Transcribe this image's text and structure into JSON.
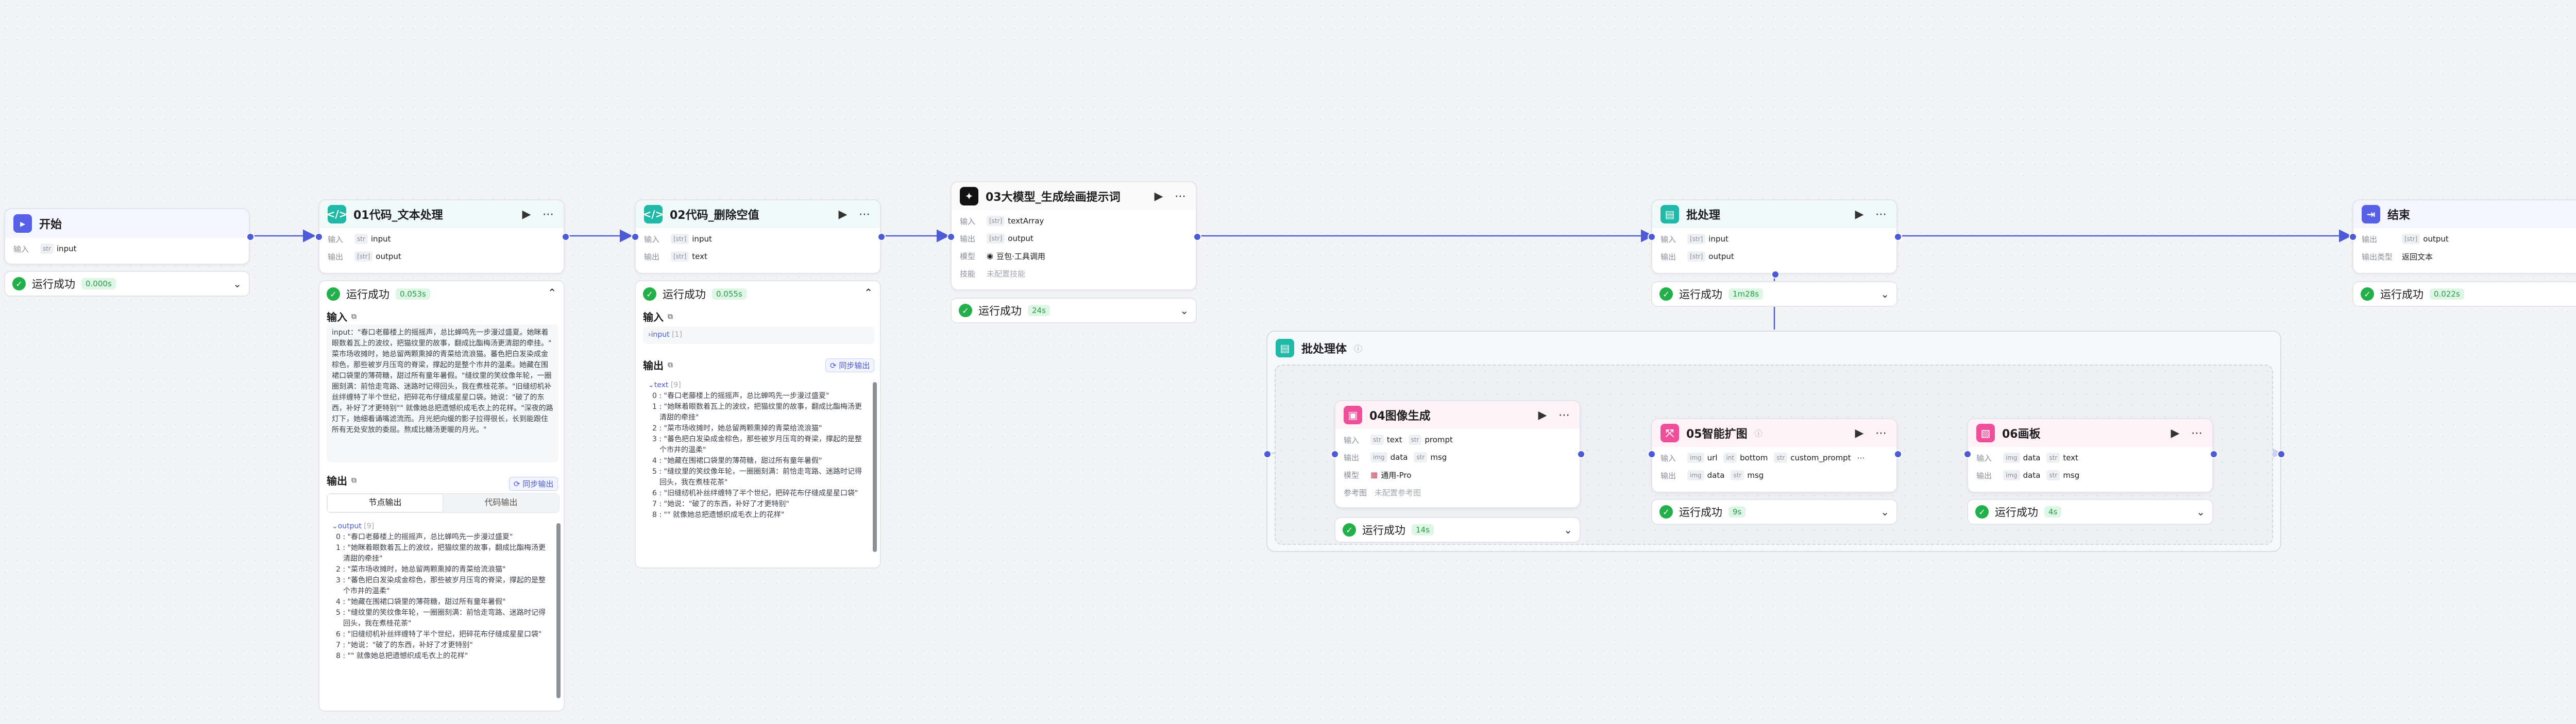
{
  "nodes": {
    "start": {
      "title": "开始",
      "input_label": "输入",
      "input_var": "input"
    },
    "n01": {
      "title": "01代码_文本处理",
      "in_label": "输入",
      "out_label": "输出",
      "in_var": "input",
      "out_var": "output"
    },
    "n02": {
      "title": "02代码_删除空值",
      "in_label": "输入",
      "out_label": "输出",
      "in_var": "input",
      "out_var": "text"
    },
    "n03": {
      "title": "03大模型_生成绘画提示词",
      "in_label": "输入",
      "out_label": "输出",
      "model_label": "模型",
      "skill_label": "技能",
      "in_var": "textArray",
      "out_var": "output",
      "model_value": "豆包·工具调用",
      "skill_value": "未配置技能"
    },
    "batch": {
      "title": "批处理",
      "in_label": "输入",
      "out_label": "输出",
      "in_var": "input",
      "out_var": "output"
    },
    "end": {
      "title": "结束",
      "out_label": "输出",
      "type_label": "输出类型",
      "out_var": "output",
      "type_value": "返回文本"
    },
    "batch_body": {
      "title": "批处理体",
      "info_icon": "info-icon"
    },
    "n04": {
      "title": "04图像生成",
      "in_label": "输入",
      "out_label": "输出",
      "model_label": "模型",
      "ref_label": "参考图",
      "in_vars": [
        "text",
        "prompt"
      ],
      "out_vars": [
        "data",
        "msg"
      ],
      "model_value": "通用-Pro",
      "ref_value": "未配置参考图"
    },
    "n05": {
      "title": "05智能扩图",
      "in_label": "输入",
      "out_label": "输出",
      "in_vars": [
        "url",
        "bottom",
        "custom_prompt"
      ],
      "out_vars": [
        "data",
        "msg"
      ]
    },
    "n06": {
      "title": "06画板",
      "in_label": "输入",
      "out_label": "输出",
      "in_vars": [
        "data",
        "text"
      ],
      "out_vars": [
        "data",
        "msg"
      ]
    }
  },
  "status": {
    "label": "运行成功",
    "start_time": "0.000s",
    "n01_time": "0.053s",
    "n02_time": "0.055s",
    "n03_time": "24s",
    "batch_time": "1m28s",
    "end_time": "0.022s",
    "n04_time": "14s",
    "n05_time": "9s",
    "n06_time": "4s"
  },
  "panel01": {
    "input_title": "输入",
    "input_text": "input：\"春口老藤楼上的摇摇声，总比蝉鸣先一步漫过盛夏。她眯着眼数着瓦上的波纹，把猫纹里的故事，翻成比酯梅汤更清甜的牵挂。\" 菜市场收摊时，她总留两颗熏掉的青菜给流浪猫。蕃色把白发染成金棕色，那些被岁月压弯的脊梁，撑起的是整个市井的温柔。她藏在围裙口袋里的薄荷糖，甜过所有童年暑假。\"缝纹里的笑纹像年轮，一圈圈刻满：前恰走弯路、迷路时记得回头，我在煮桂花茶。\"旧缝纫机补丝绊缠特了半个世纪，把碎花布仔缝成星星口袋。她说：\"破了的东西，补好了才更特别\"\" 就像她总把遗憾织成毛衣上的花样。\"深夜的路灯下，她细看诵嘴滤流而。月光把向缓的影子拉得很长，长到能跟住所有无处安放的委屈。熬成比糖汤更暖的月光。\"",
    "output_title": "输出",
    "sync_label": "同步输出",
    "tab_node": "节点输出",
    "tab_code": "代码输出",
    "output_key": "output",
    "output_count": "[9]",
    "output_items": [
      "0 : \"春口老藤楼上的摇摇声，总比蝉鸣先一步漫过盛夏\"",
      "1 : \"她眯着眼数着瓦上的波纹，把猫纹里的故事，翻成比酯梅汤更清甜的牵挂\"",
      "2 : \"菜市场收摊时，她总留两颗熏掉的青菜给流浪猫\"",
      "3 : \"蕃色把白发染成金棕色，那些被岁月压弯的脊梁，撑起的是整个市井的温柔\"",
      "4 : \"她藏在围裙口袋里的薄荷糖，甜过所有童年暑假\"",
      "5 : \"缝纹里的笑纹像年轮，一圈圈刻满：前恰走弯路、迷路时记得回头，我在煮桂花茶\"",
      "6 : \"旧缝纫机补丝绊缠特了半个世纪，把碎花布仔缝成星星口袋\"",
      "7 : \"她说：\"破了的东西，补好了才更特别\"",
      "8 : \"\" 就像她总把遗憾织成毛衣上的花样\""
    ]
  },
  "panel02": {
    "input_title": "输入",
    "input_key": "input",
    "input_count": "[1]",
    "output_title": "输出",
    "sync_label": "同步输出",
    "output_key": "text",
    "output_count": "[9]",
    "output_items": [
      "0 : \"春口老藤楼上的摇摇声，总比蝉鸣先一步漫过盛夏\"",
      "1 : \"她眯着眼数着瓦上的波纹，把猫纹里的故事，翻成比酯梅汤更清甜的牵挂\"",
      "2 : \"菜市场收摊时，她总留两颗熏掉的青菜给流浪猫\"",
      "3 : \"蕃色把白发染成金棕色，那些被岁月压弯的脊梁，撑起的是整个市井的温柔\"",
      "4 : \"她藏在围裙口袋里的薄荷糖，甜过所有童年暑假\"",
      "5 : \"缝纹里的笑纹像年轮，一圈圈刻满：前恰走弯路、迷路时记得回头，我在煮桂花茶\"",
      "6 : \"旧缝纫机补丝绊缠特了半个世纪，把碎花布仔缝成星星口袋\"",
      "7 : \"她说：\"破了的东西，补好了才更特别\"",
      "8 : \"\" 就像她总把遗憾织成毛衣上的花样\""
    ]
  },
  "colors": {
    "accent": "#4d5bd6",
    "success": "#23b04a",
    "code_icon": "#20b8a6",
    "llm_icon": "#111111",
    "image_icon": "#ef4f9a",
    "start_icon": "#5661e8"
  }
}
